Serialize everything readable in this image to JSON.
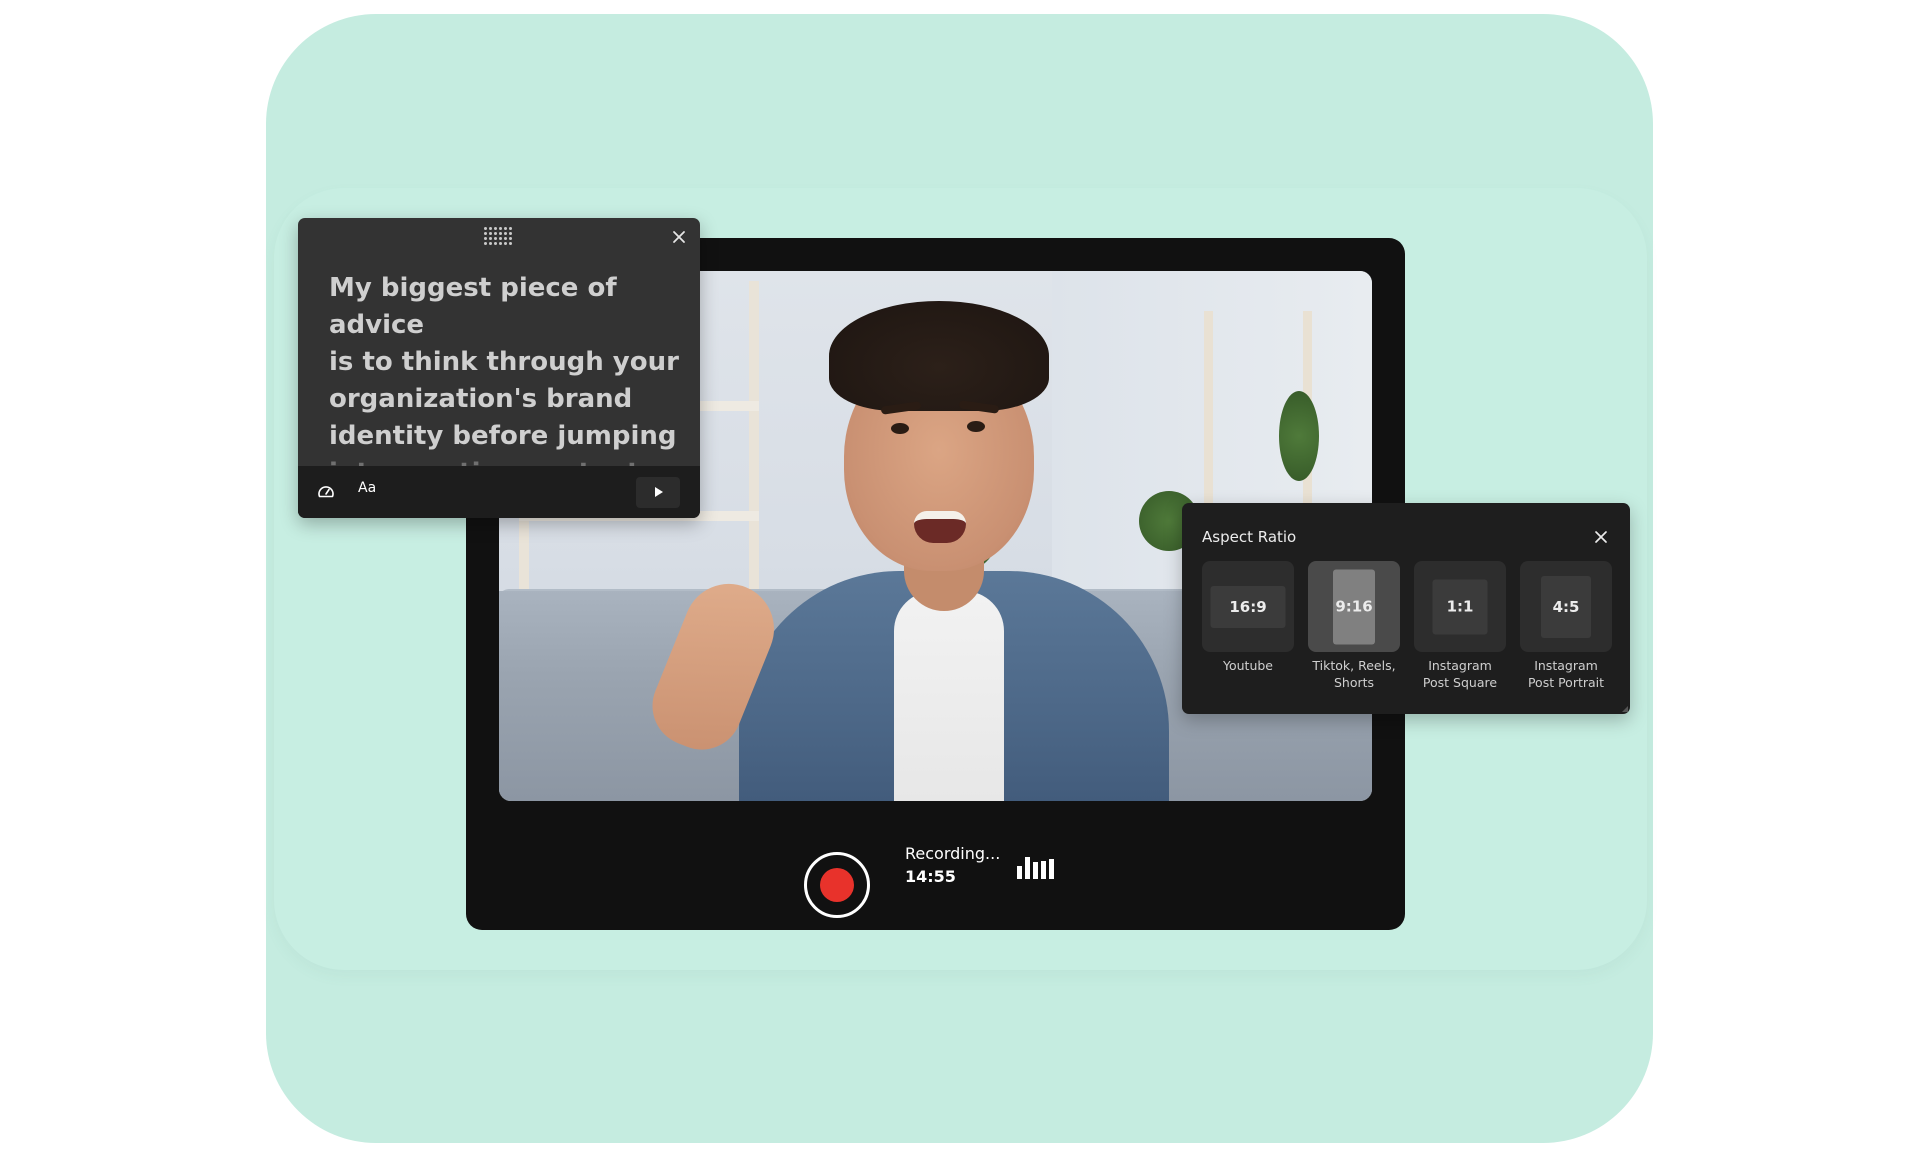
{
  "teleprompter": {
    "script_lines": [
      "My biggest piece of advice",
      "is to think through your",
      "organization's brand",
      "identity before jumping"
    ],
    "script_faded_line": "into creating content.",
    "icons": {
      "drag": "drag-grip-icon",
      "close": "close-icon",
      "speed": "speedometer-icon",
      "font": "Aa",
      "play": "play-icon"
    }
  },
  "recorder": {
    "status": "Recording...",
    "elapsed": "14:55",
    "record_color": "#e8322b",
    "audio_levels": [
      0.6,
      1.0,
      0.75,
      0.8,
      0.9
    ]
  },
  "aspect_ratio": {
    "title": "Aspect Ratio",
    "options": [
      {
        "ratio": "16:9",
        "label_line1": "Youtube",
        "label_line2": "",
        "selected": false
      },
      {
        "ratio": "9:16",
        "label_line1": "Tiktok, Reels,",
        "label_line2": "Shorts",
        "selected": true
      },
      {
        "ratio": "1:1",
        "label_line1": "Instagram",
        "label_line2": "Post Square",
        "selected": false
      },
      {
        "ratio": "4:5",
        "label_line1": "Instagram",
        "label_line2": "Post Portrait",
        "selected": false
      }
    ]
  },
  "colors": {
    "background": "#c5ece0",
    "frame": "#111111",
    "panel": "#1e1e1e",
    "prompter": "#333333"
  }
}
